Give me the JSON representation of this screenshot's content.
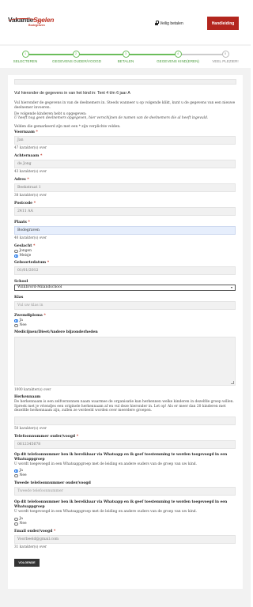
{
  "header": {
    "logo_part1": "Vakantie",
    "logo_part2": "Spelen",
    "logo_sub": "Bodegraven",
    "secure_text": "Veilig betalen",
    "cart_button": "Handleiding"
  },
  "steps": [
    {
      "number": "1",
      "label": "SELECTEREN",
      "state": "done"
    },
    {
      "number": "2",
      "label": "GEGEVENS OUDER/VOOGD",
      "state": "done"
    },
    {
      "number": "3",
      "label": "BETALEN",
      "state": "done"
    },
    {
      "number": "4",
      "label": "GEGEVENS KIND(EREN)",
      "state": "active"
    },
    {
      "number": "5",
      "label": "VEEL PLEZIER!",
      "state": "todo"
    }
  ],
  "form": {
    "section_title": "Vul hieronder de gegevens in van het kind in: Tent 4 t/m 6 jaar A",
    "intro": "Vul hieronder de gegevens in van de deelnemers in. Steeds wanneer u op volgende klikt, kunt u de gegevens van een nieuwe deelnemer invoeren.",
    "kids_label": "De volgende kinderen hebt u opgegeven:",
    "kids_note": "U heeft nog geen deelnemers opgegeven, hier verschijnen de namen van de deelnemers die al heeft ingevuld.",
    "required_note": "Velden die gemarkeerd zijn met een * zijn verplichte velden.",
    "voornaam": {
      "label": "Voornaam",
      "value": "Jan",
      "hint": "47 karakter(s) over"
    },
    "achternaam": {
      "label": "Achternaam",
      "value": "de Jong",
      "hint": "43 karakter(s) over"
    },
    "adres": {
      "label": "Adres",
      "value": "Beekstraat 1",
      "hint": "38 karakter(s) over"
    },
    "postcode": {
      "label": "Postcode",
      "value": "2411 AA"
    },
    "plaats": {
      "label": "Plaats",
      "value": "Bodegraven",
      "hint": "40 karakter(s) over"
    },
    "geslacht": {
      "label": "Geslacht",
      "options": [
        "Jongen",
        "Meisje"
      ],
      "selected": "Meisje"
    },
    "geboortedatum": {
      "label": "Geboortedatum",
      "value": "01/01/2012"
    },
    "school": {
      "label": "School",
      "value": "Willibrord-Milandschool"
    },
    "klas": {
      "label": "Klas",
      "placeholder": "Vul uw klas in"
    },
    "zwemdiploma": {
      "label": "Zwemdiploma",
      "options": [
        "Ja",
        "Nee"
      ],
      "selected": "Ja"
    },
    "medicijnen": {
      "label": "Medicijnen/Dieet/Andere bijzonderheden",
      "hint": "1000 karakter(s) over"
    },
    "herkennaam": {
      "label": "Herkennaam",
      "description": "De herkennaam is een zelfverzonnen naam waarmee de organisatie kan herkennen welke kinderen in dezelfde groep willen. Spreek met je vriendjes een originele herkennaam af en vul deze hieronder in. Let op! Als er meer dan 20 kinderen met dezelfde herkennaam zijn, zullen ze verdeeld worden over meerdere groepen.",
      "hint": "50 karakter(s) over"
    },
    "telefoon": {
      "label": "Telefoonnummer ouder/voogd",
      "value": "0612345678"
    },
    "whatsapp1": {
      "label": "Op dit telefoonnummer ben ik bereikbaar via Whatsapp en ik geef toestemming te worden toegevoegd in een Whatsappgroep",
      "description": "U wordt toegevoegd in een Whatsappgroep met de leiding en andere ouders van de groep van uw kind.",
      "options": [
        "Ja",
        "Nee"
      ],
      "selected": "Ja"
    },
    "telefoon2": {
      "label": "Tweede telefoonnummer ouder/voogd",
      "placeholder": "Tweede telefoonnummer"
    },
    "whatsapp2": {
      "label": "Op dit telefoonnummer ben ik bereikbaar via Whatsapp en ik geef toestemming te worden toegevoegd in een Whatsappgroep",
      "description": "U wordt toegevoegd in een Whatsappgroep met de leiding en andere ouders van de groep van uw kind.",
      "options": [
        "Ja",
        "Nee"
      ],
      "selected": ""
    },
    "email": {
      "label": "Email ouder/voogd",
      "value": "Voorbeeld@gmail.com",
      "hint": "31 karakter(s) over"
    },
    "next_button": "VOLGENDE"
  },
  "colors": {
    "accent_green": "#6bbd5b",
    "brand_red": "#b3261e",
    "required_red": "#c0392b"
  }
}
